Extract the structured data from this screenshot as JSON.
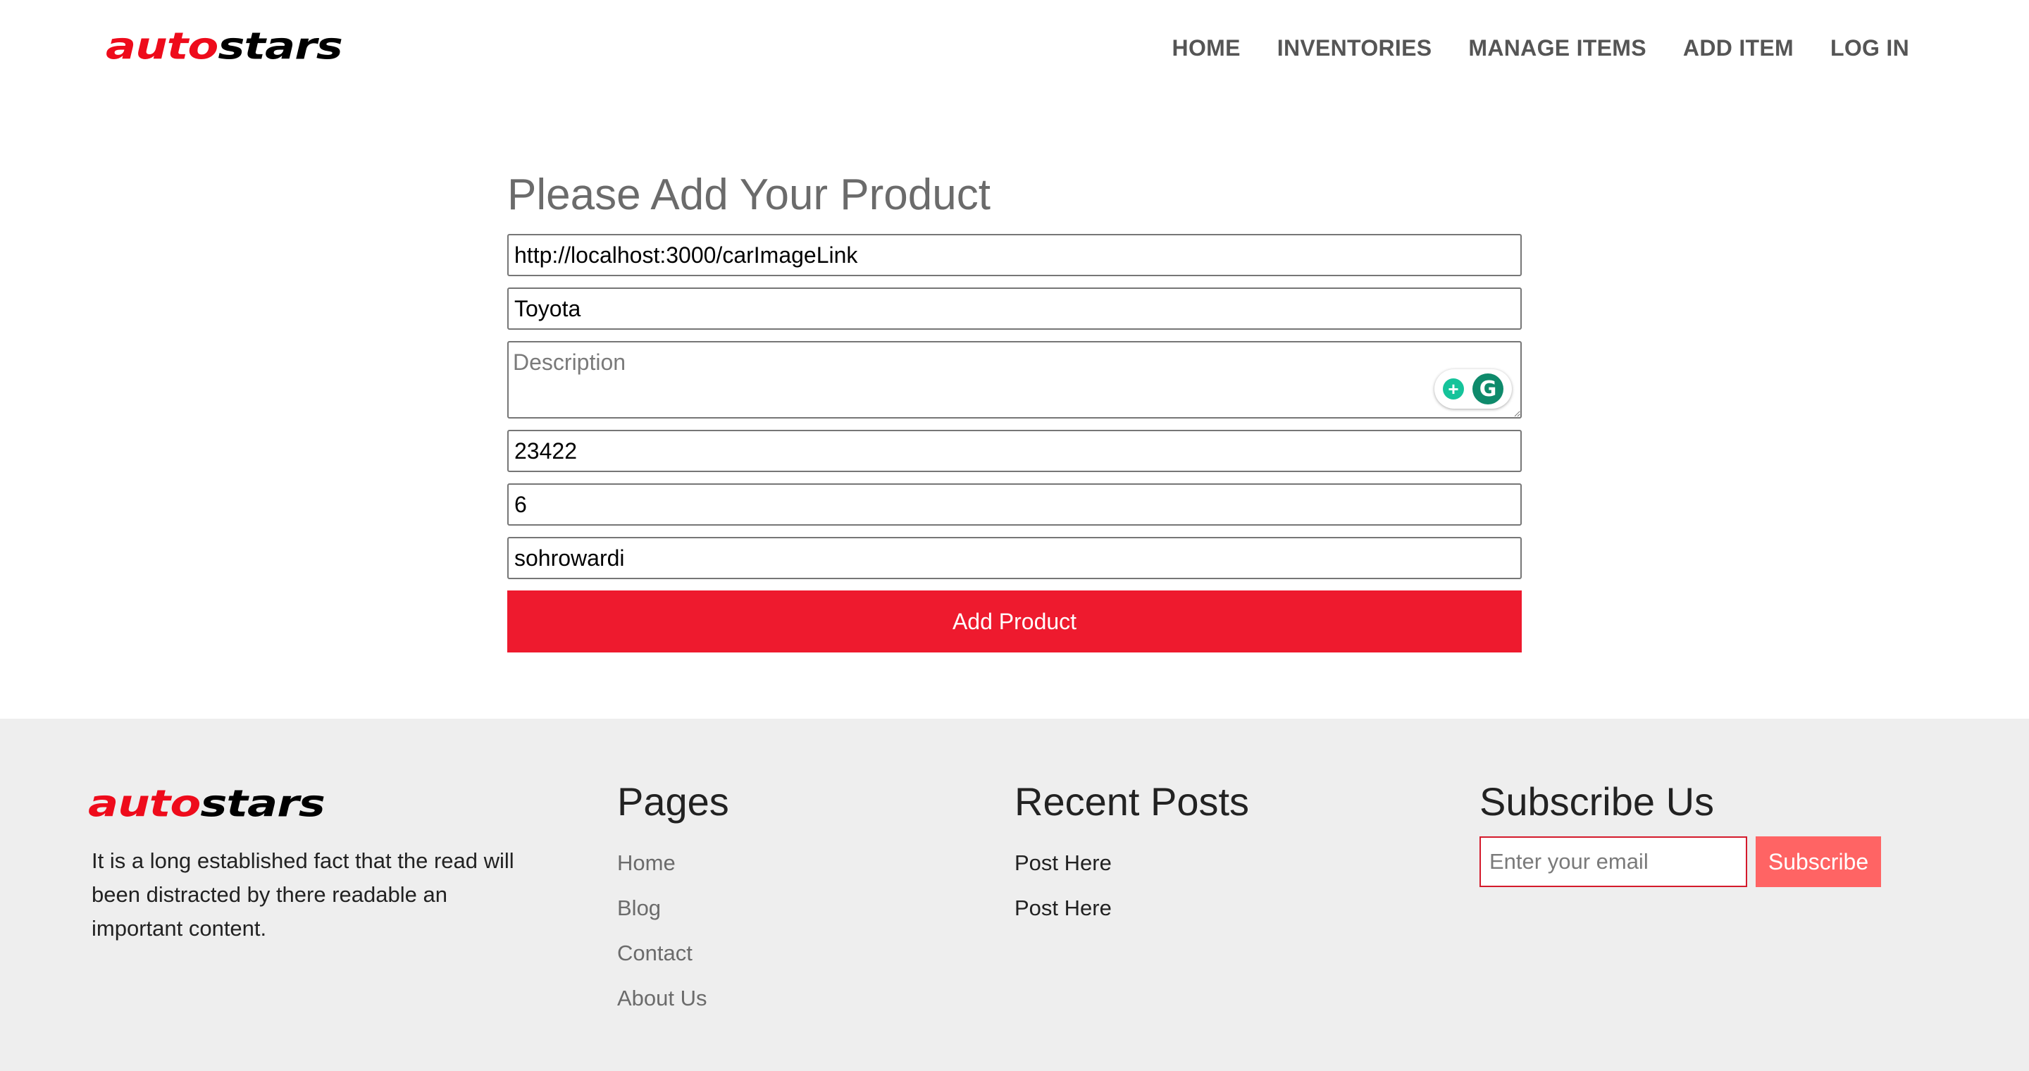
{
  "brand": {
    "logo_red": "auto",
    "logo_black": "stars"
  },
  "nav": [
    {
      "label": "HOME"
    },
    {
      "label": "INVENTORIES"
    },
    {
      "label": "MANAGE ITEMS"
    },
    {
      "label": "ADD ITEM"
    },
    {
      "label": "LOG IN"
    }
  ],
  "form": {
    "title": "Please Add Your Product",
    "image_link": "http://localhost:3000/carImageLink",
    "name": "Toyota",
    "description_placeholder": "Description",
    "price": "23422",
    "quantity": "6",
    "supplier": "sohrowardi",
    "submit_label": "Add Product"
  },
  "grammarly": {
    "bulb_icon": "+",
    "logo_icon": "G"
  },
  "footer": {
    "about": "It is a long established fact that the read will been distracted by there readable an important content.",
    "pages_title": "Pages",
    "pages": [
      "Home",
      "Blog",
      "Contact",
      "About Us"
    ],
    "posts_title": "Recent Posts",
    "posts": [
      "Post Here",
      "Post Here"
    ],
    "subscribe_title": "Subscribe Us",
    "email_placeholder": "Enter your email",
    "subscribe_label": "Subscribe"
  },
  "colors": {
    "accent_red": "#ee1a2e",
    "subscribe_button": "#ff6464",
    "footer_bg": "#eeeeee",
    "nav_text": "#555555"
  }
}
